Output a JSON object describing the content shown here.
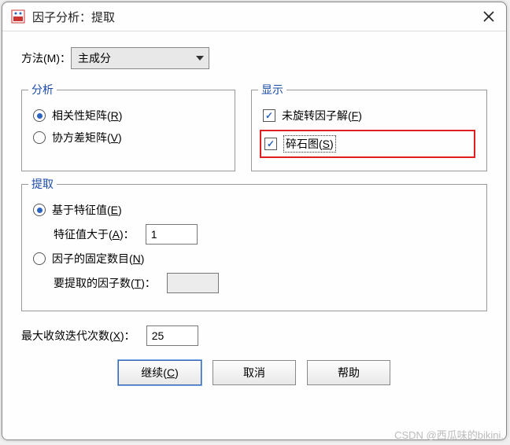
{
  "title": "因子分析：提取",
  "method": {
    "label": "方法(M)：",
    "value": "主成分"
  },
  "panels": {
    "analyze": {
      "legend": "分析",
      "opt_correlation": "相关性矩阵(R)",
      "opt_covariance": "协方差矩阵(V)",
      "selected": "correlation"
    },
    "display": {
      "legend": "显示",
      "opt_unrotated": "未旋转因子解(F)",
      "opt_scree": "碎石图(S)"
    },
    "extract": {
      "legend": "提取",
      "opt_eigen": "基于特征值(E)",
      "eigen_sub_label": "特征值大于(A)：",
      "eigen_value": "1",
      "opt_fixed": "因子的固定数目(N)",
      "fixed_sub_label": "要提取的因子数(T)：",
      "fixed_value": "",
      "selected": "eigen"
    }
  },
  "iterations": {
    "label": "最大收敛迭代次数(X)：",
    "value": "25"
  },
  "buttons": {
    "continue": "继续(C)",
    "cancel": "取消",
    "help": "帮助"
  },
  "watermark": "CSDN @西瓜味的bikini."
}
